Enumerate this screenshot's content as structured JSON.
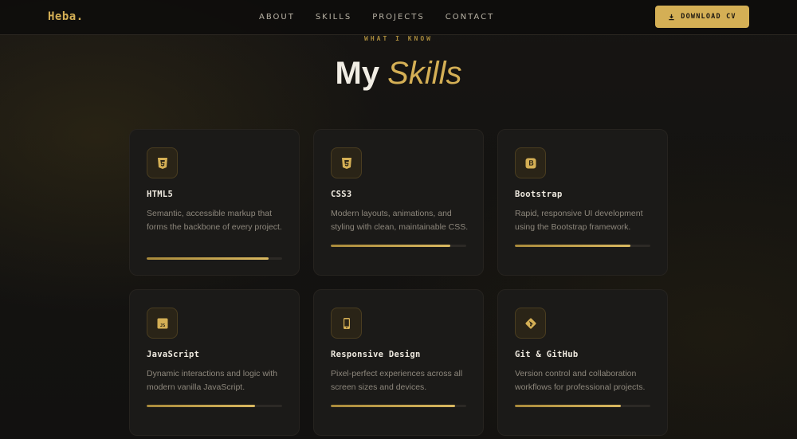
{
  "nav": {
    "logo": "Heba.",
    "links": [
      "ABOUT",
      "SKILLS",
      "PROJECTS",
      "CONTACT"
    ],
    "cv_button": "DOWNLOAD CV"
  },
  "section": {
    "eyebrow": "WHAT I KNOW",
    "title": "My",
    "title_accent": "Skills"
  },
  "skills": [
    {
      "icon": "html5-icon",
      "title": "HTML5",
      "desc": "Semantic, accessible markup that forms the backbone of every project.",
      "level": 0.9
    },
    {
      "icon": "css3-icon",
      "title": "CSS3",
      "desc": "Modern layouts, animations, and styling with clean, maintainable CSS.",
      "level": 0.88
    },
    {
      "icon": "bootstrap-icon",
      "title": "Bootstrap",
      "desc": "Rapid, responsive UI development using the Bootstrap framework.",
      "level": 0.85
    },
    {
      "icon": "javascript-icon",
      "title": "JavaScript",
      "desc": "Dynamic interactions and logic with modern vanilla JavaScript.",
      "level": 0.8
    },
    {
      "icon": "mobile-icon",
      "title": "Responsive Design",
      "desc": "Pixel-perfect experiences across all screen sizes and devices.",
      "level": 0.92
    },
    {
      "icon": "git-icon",
      "title": "Git & GitHub",
      "desc": "Version control and collaboration workflows for professional projects.",
      "level": 0.78
    }
  ],
  "colors": {
    "accent": "#d4af55",
    "background": "#121110",
    "card": "#1b1a18"
  }
}
